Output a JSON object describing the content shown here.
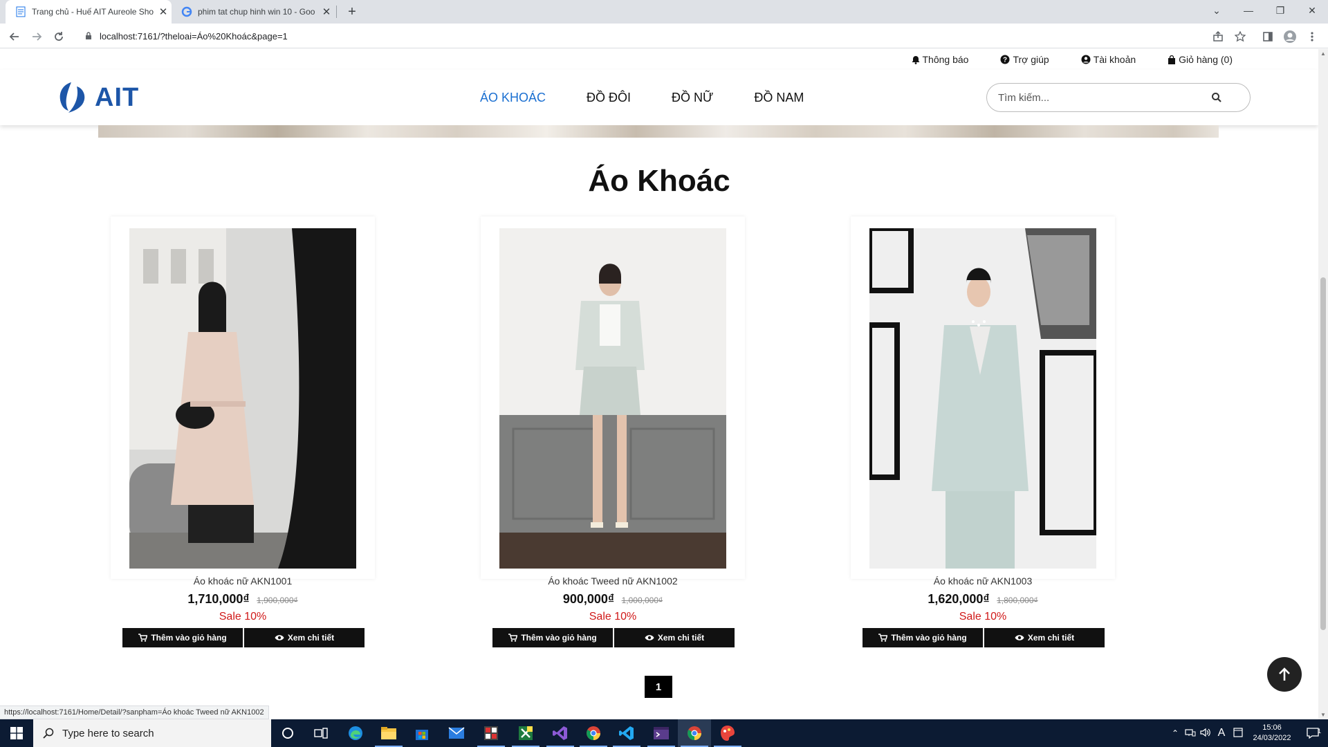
{
  "browser": {
    "tabs": [
      {
        "title": "Trang chủ - Huế AIT Aureole Sho",
        "active": true
      },
      {
        "title": "phim tat chup hinh win 10 - Goo",
        "active": false
      }
    ],
    "new_tab": "+",
    "url": "localhost:7161/?theloai=Áo%20Khoác&page=1",
    "status_url": "https://localhost:7161/Home/Detail/?sanpham=Áo khoác Tweed nữ AKN1002"
  },
  "site": {
    "topbar": {
      "notifications": "Thông báo",
      "help": "Trợ giúp",
      "account": "Tài khoản",
      "cart": "Giỏ hàng (0)"
    },
    "logo": "AIT",
    "menu": [
      {
        "label": "ÁO KHOÁC",
        "active": true
      },
      {
        "label": "ĐỒ ĐÔI",
        "active": false
      },
      {
        "label": "ĐỒ NỮ",
        "active": false
      },
      {
        "label": "ĐỒ NAM",
        "active": false
      }
    ],
    "search_placeholder": "Tìm kiếm...",
    "section_title": "Áo Khoác",
    "add_to_cart_label": "Thêm vào giỏ hàng",
    "view_detail_label": "Xem chi tiết",
    "products": [
      {
        "name": "Áo khoác nữ AKN1001",
        "price": "1,710,000₫",
        "old_price": "1,900,000₫",
        "sale": "Sale 10%"
      },
      {
        "name": "Áo khoác Tweed nữ AKN1002",
        "price": "900,000₫",
        "old_price": "1,000,000₫",
        "sale": "Sale 10%"
      },
      {
        "name": "Áo khoác nữ AKN1003",
        "price": "1,620,000₫",
        "old_price": "1,800,000₫",
        "sale": "Sale 10%"
      }
    ],
    "pagination": {
      "current": "1"
    }
  },
  "taskbar": {
    "search_placeholder": "Type here to search",
    "time": "15:06",
    "date": "24/03/2022",
    "notification_count": "1",
    "ime": "A"
  },
  "colors": {
    "accent": "#1a6fd1",
    "logo": "#1d56a8",
    "sale": "#d01818",
    "button": "#111111"
  }
}
